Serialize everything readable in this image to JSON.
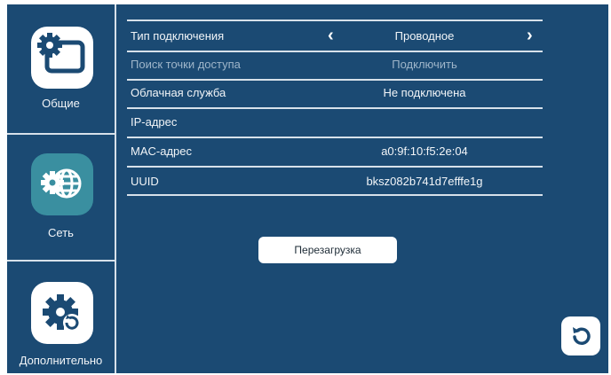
{
  "sidebar": {
    "items": [
      {
        "label": "Общие",
        "icon": "settings-screen-icon"
      },
      {
        "label": "Сеть",
        "icon": "network-globe-icon"
      },
      {
        "label": "Дополнительно",
        "icon": "advanced-gear-icon"
      }
    ],
    "active_index": 1
  },
  "settings": {
    "rows": [
      {
        "label": "Тип подключения",
        "value": "Проводное"
      },
      {
        "label": "Поиск точки доступа",
        "value": "Подключить"
      },
      {
        "label": "Облачная служба",
        "value": "Не подключена"
      },
      {
        "label": "IP-адрес",
        "value": ""
      },
      {
        "label": "MAC-адрес",
        "value": "a0:9f:10:f5:2e:04"
      },
      {
        "label": "UUID",
        "value": "bksz082b741d7efffe1g"
      }
    ]
  },
  "reboot_button": {
    "label": "Перезагрузка"
  },
  "refresh_button": {
    "icon": "refresh-icon"
  },
  "colors": {
    "background": "#1b4a73",
    "active_icon": "#3a8fa0",
    "divider": "#d7e1ea"
  }
}
